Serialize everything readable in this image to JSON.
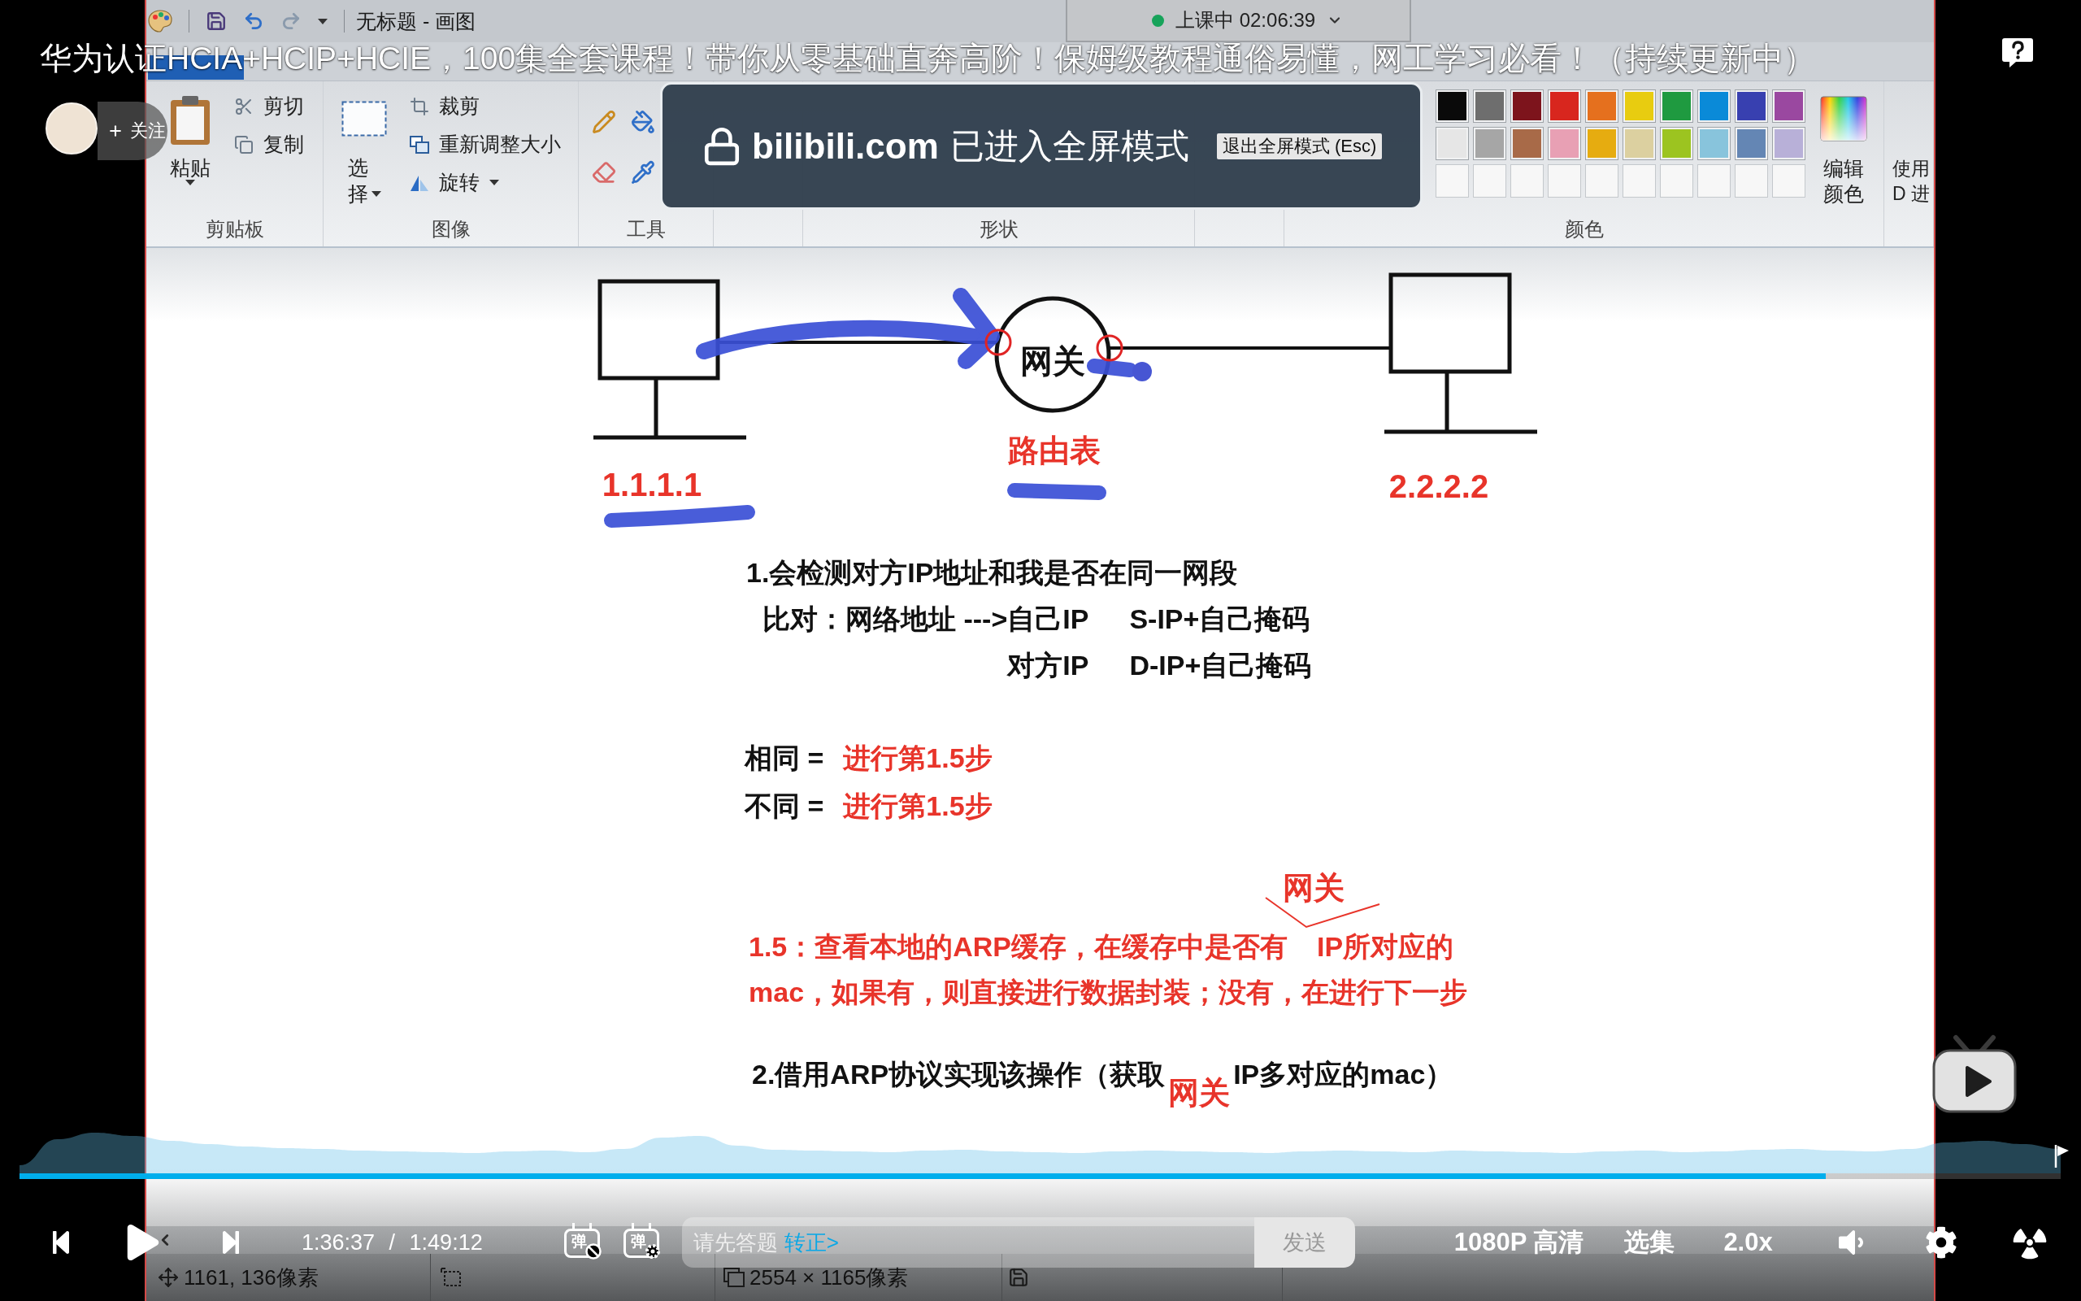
{
  "video_title": "华为认证HCIA+HCIP+HCIE，100集全套课程！带你从零基础直奔高阶！保姆级教程通俗易懂，网工学习必看！（持续更新中）",
  "follow": {
    "label": "关注"
  },
  "fullscreen_notice": {
    "site": "bilibili.com",
    "message": "已进入全屏模式",
    "exit_button": "退出全屏模式 (Esc)"
  },
  "recording": {
    "live_status": "上课中 02:06:39",
    "paint": {
      "title": "无标题 - 画图",
      "ribbon": {
        "clipboard": {
          "paste": "粘贴",
          "cut": "剪切",
          "copy": "复制",
          "group_label": "剪贴板"
        },
        "image": {
          "select": "选择",
          "crop": "裁剪",
          "resize": "重新调整大小",
          "rotate": "旋转",
          "group_label": "图像"
        },
        "tools": {
          "group_label": "工具"
        },
        "shapes": {
          "group_label": "形状"
        },
        "colors": {
          "palette": [
            {
              "kind": "color",
              "color": "#0a0a0a"
            },
            {
              "kind": "color",
              "color": "#6e6e6e"
            },
            {
              "kind": "color",
              "color": "#7d141c"
            },
            {
              "kind": "color",
              "color": "#d8261e"
            },
            {
              "kind": "color",
              "color": "#e5701e"
            },
            {
              "kind": "color",
              "color": "#e8cc10"
            },
            {
              "kind": "color",
              "color": "#1f9a40"
            },
            {
              "kind": "color",
              "color": "#0a8ad8"
            },
            {
              "kind": "color",
              "color": "#3840b0"
            },
            {
              "kind": "color",
              "color": "#9a48a0"
            },
            {
              "kind": "color",
              "color": "#e6e6e6"
            },
            {
              "kind": "color",
              "color": "#a6a6a6"
            },
            {
              "kind": "color",
              "color": "#a86a48"
            },
            {
              "kind": "color",
              "color": "#e8a0b4"
            },
            {
              "kind": "color",
              "color": "#e6ac10"
            },
            {
              "kind": "color",
              "color": "#dcd0a0"
            },
            {
              "kind": "color",
              "color": "#9cc420"
            },
            {
              "kind": "color",
              "color": "#88c4dc"
            },
            {
              "kind": "color",
              "color": "#6486b4"
            },
            {
              "kind": "color",
              "color": "#b8b0d8"
            },
            {
              "kind": "empty"
            },
            {
              "kind": "empty"
            },
            {
              "kind": "empty"
            },
            {
              "kind": "empty"
            },
            {
              "kind": "empty"
            },
            {
              "kind": "empty"
            },
            {
              "kind": "empty"
            },
            {
              "kind": "empty"
            },
            {
              "kind": "empty"
            },
            {
              "kind": "empty"
            }
          ],
          "edit_colors": "编辑颜色",
          "group_label": "颜色"
        },
        "paint_3d": [
          "使用",
          "D 进"
        ]
      },
      "canvas": {
        "diagram": {
          "left_host": "1.1.1.1",
          "gateway": "网关",
          "gateway_note": "路由表",
          "right_host": "2.2.2.2"
        },
        "notes": {
          "step_1": "1.会检测对方IP地址和我是否在同一网段",
          "comparison": [
            {
              "left": "比对：网络地址 --->自己IP",
              "right": "S-IP+自己掩码"
            },
            {
              "left": "对方IP",
              "right": "D-IP+自己掩码"
            }
          ],
          "outcomes": [
            {
              "condition": "相同 =",
              "action": "进行第1.5步"
            },
            {
              "condition": "不同 =",
              "action": "进行第1.5步"
            }
          ],
          "step_1_5": {
            "before": "1.5：查看本地的ARP缓存，在缓存中是否有",
            "insert": "网关",
            "after": "IP所对应的",
            "continued": "mac，如果有，则直接进行数据封装；没有，在进行下一步"
          },
          "step_2": {
            "before": "2.借用ARP协议实现该操作（获取",
            "insert": "网关",
            "after": "IP多对应的mac）"
          }
        }
      },
      "status_bar": {
        "cursor_position": "1161, 136像素",
        "canvas_size": "2554 × 1165像素"
      }
    }
  },
  "player": {
    "progress": {
      "level": 0.885
    },
    "controls": {
      "playing": false,
      "time": "1:36:37 / 1:49:12",
      "danmaku_toggles": [
        {
          "kind": "switch",
          "label": "弹",
          "on": false
        },
        {
          "kind": "settings",
          "label": "弹"
        }
      ],
      "danmaku_input": {
        "placeholder": "请先答题",
        "link": "转正>",
        "send_button": "发送"
      },
      "quality": "1080P 高清",
      "episodes": "选集",
      "speed": "2.0x"
    }
  }
}
